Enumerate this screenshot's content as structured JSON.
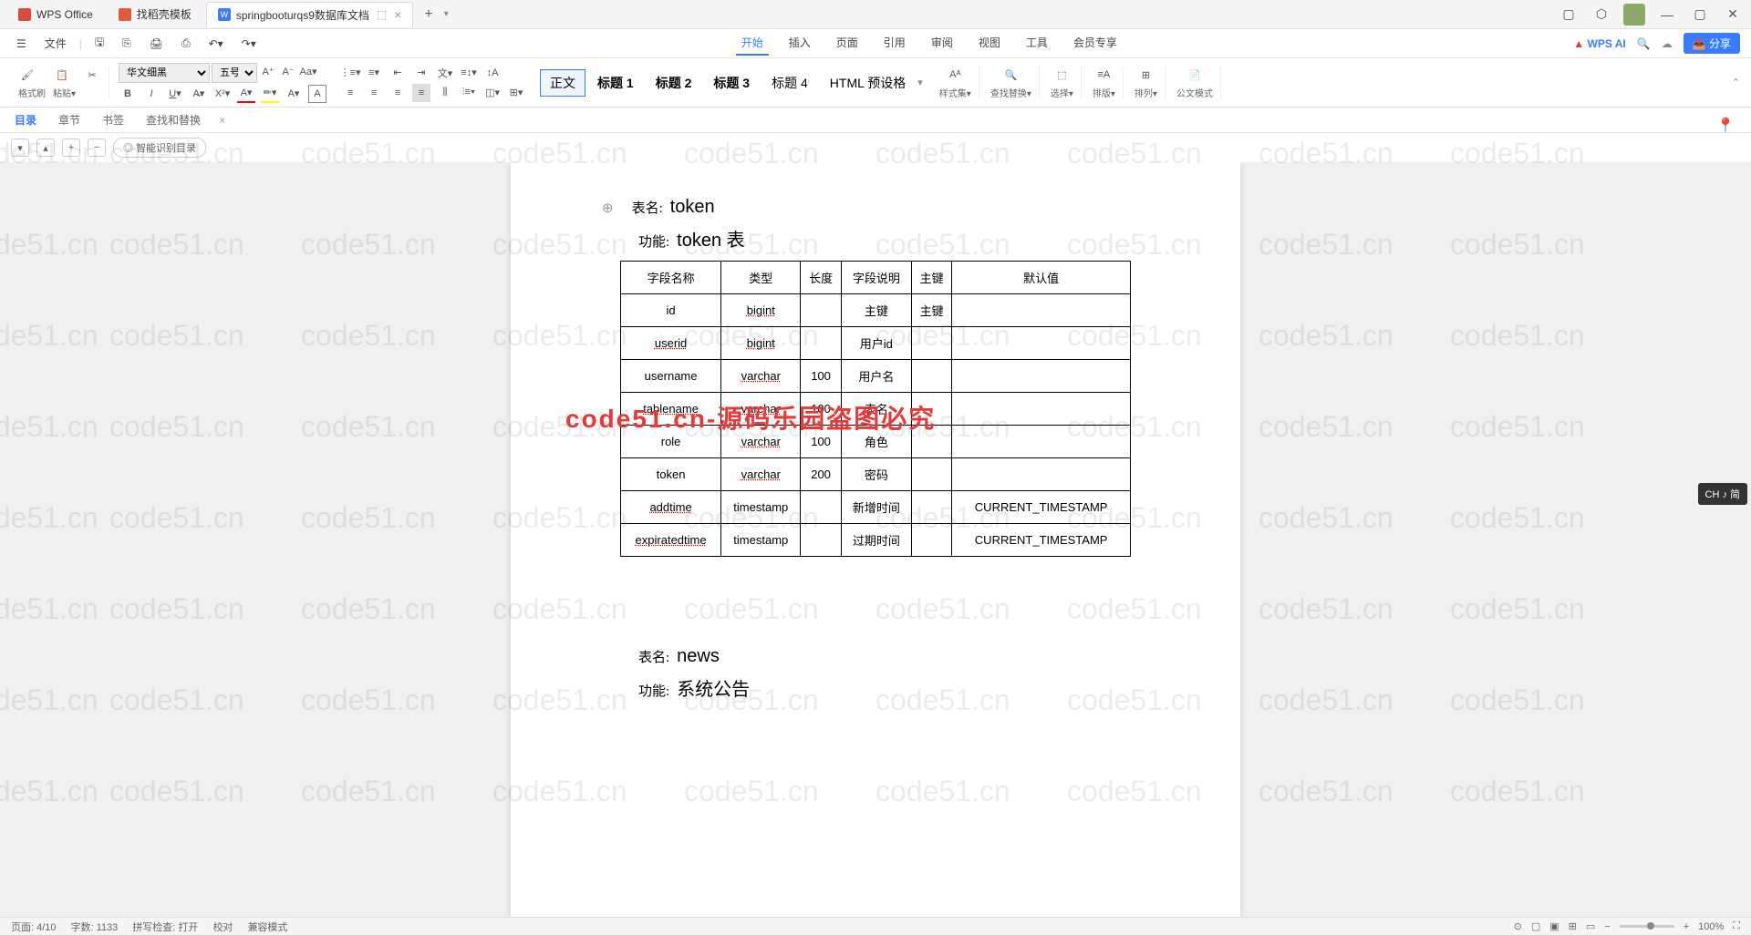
{
  "tabs": [
    {
      "label": "WPS Office",
      "icon_color": "#d94b3a"
    },
    {
      "label": "找稻壳模板",
      "icon_color": "#e05a3a"
    },
    {
      "label": "springbooturqs9数据库文档",
      "icon_color": "#3a7cff",
      "active": true
    }
  ],
  "menubar": {
    "file": "文件",
    "tabs": [
      "开始",
      "插入",
      "页面",
      "引用",
      "审阅",
      "视图",
      "工具",
      "会员专享"
    ],
    "wps_ai": "WPS AI",
    "share": "分享"
  },
  "ribbon": {
    "format_painter": "格式刷",
    "paste": "粘贴",
    "font_name": "华文细黑",
    "font_size": "五号",
    "styles": {
      "normal": "正文",
      "h1": "标题 1",
      "h2": "标题 2",
      "h3": "标题 3",
      "h4": "标题 4",
      "html": "HTML 预设格"
    },
    "style_set": "样式集",
    "find_replace": "查找替换",
    "select": "选择",
    "sort": "排版",
    "arrange": "排列",
    "official": "公文模式"
  },
  "nav": {
    "tabs": [
      "目录",
      "章节",
      "书签",
      "查找和替换"
    ],
    "smart": "智能识别目录"
  },
  "doc": {
    "table_name_label": "表名:",
    "table1_name": "token",
    "function_label": "功能:",
    "table1_func": "token 表",
    "headers": [
      "字段名称",
      "类型",
      "长度",
      "字段说明",
      "主键",
      "默认值"
    ],
    "rows": [
      {
        "name": "id",
        "type": "bigint",
        "len": "",
        "desc": "主键",
        "pk": "主键",
        "def": ""
      },
      {
        "name": "userid",
        "type": "bigint",
        "len": "",
        "desc": "用户id",
        "pk": "",
        "def": ""
      },
      {
        "name": "username",
        "type": "varchar",
        "len": "100",
        "desc": "用户名",
        "pk": "",
        "def": ""
      },
      {
        "name": "tablename",
        "type": "varchar",
        "len": "100",
        "desc": "表名",
        "pk": "",
        "def": ""
      },
      {
        "name": "role",
        "type": "varchar",
        "len": "100",
        "desc": "角色",
        "pk": "",
        "def": ""
      },
      {
        "name": "token",
        "type": "varchar",
        "len": "200",
        "desc": "密码",
        "pk": "",
        "def": ""
      },
      {
        "name": "addtime",
        "type": "timestamp",
        "len": "",
        "desc": "新增时间",
        "pk": "",
        "def": "CURRENT_TIMESTAMP"
      },
      {
        "name": "expiratedtime",
        "type": "timestamp",
        "len": "",
        "desc": "过期时间",
        "pk": "",
        "def": "CURRENT_TIMESTAMP"
      }
    ],
    "table2_name": "news",
    "table2_func": "系统公告",
    "watermark_main": "code51.cn-源码乐园盗图必究",
    "watermark_bg": "code51.cn"
  },
  "status": {
    "page": "页面: 4/10",
    "words": "字数: 1133",
    "spell": "拼写检查: 打开",
    "proof": "校对",
    "mode": "兼容模式",
    "zoom": "100%"
  },
  "ime": "CH ♪ 简"
}
